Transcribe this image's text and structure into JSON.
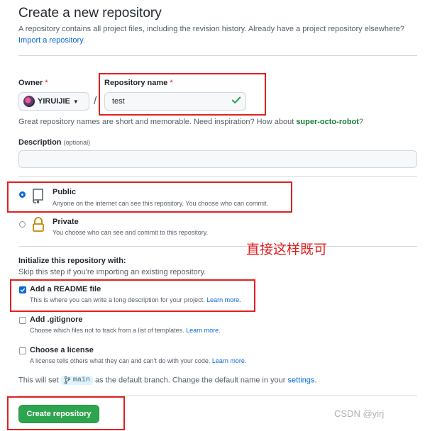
{
  "header": {
    "title": "Create a new repository",
    "subtitle": "A repository contains all project files, including the revision history. Already have a project repository elsewhere?",
    "import_link": "Import a repository."
  },
  "owner": {
    "label": "Owner",
    "required_mark": "*",
    "value": "YIRUIJIE"
  },
  "repo_name": {
    "label": "Repository name",
    "required_mark": "*",
    "value": "test"
  },
  "name_hint": {
    "text": "Great repository names are short and memorable. Need inspiration? How about ",
    "suggestion": "super-octo-robot",
    "suffix": "?"
  },
  "description": {
    "label": "Description",
    "optional": "(optional)",
    "value": ""
  },
  "visibility": {
    "public": {
      "title": "Public",
      "desc": "Anyone on the internet can see this repository. You choose who can commit.",
      "selected": true
    },
    "private": {
      "title": "Private",
      "desc": "You choose who can see and commit to this repository.",
      "selected": false
    }
  },
  "initialize": {
    "heading": "Initialize this repository with:",
    "skip_text": "Skip this step if you're importing an existing repository.",
    "readme": {
      "title": "Add a README file",
      "desc": "This is where you can write a long description for your project.",
      "link": "Learn more.",
      "checked": true
    },
    "gitignore": {
      "title": "Add .gitignore",
      "desc": "Choose which files not to track from a list of templates.",
      "link": "Learn more.",
      "checked": false
    },
    "license": {
      "title": "Choose a license",
      "desc": "A license tells others what they can and can't do with your code.",
      "link": "Learn more.",
      "checked": false
    }
  },
  "branch_note": {
    "prefix": "This will set",
    "branch": "main",
    "middle": "as the default branch. Change the default name in your",
    "link": "settings",
    "suffix": "."
  },
  "annotation": "直接这样既可",
  "create_button": "Create repository",
  "watermark": "CSDN @yirj",
  "colors": {
    "accent": "#0969da",
    "primary_button": "#2da44e",
    "annotation_red": "#e02020",
    "success_green": "#1a7f37"
  }
}
